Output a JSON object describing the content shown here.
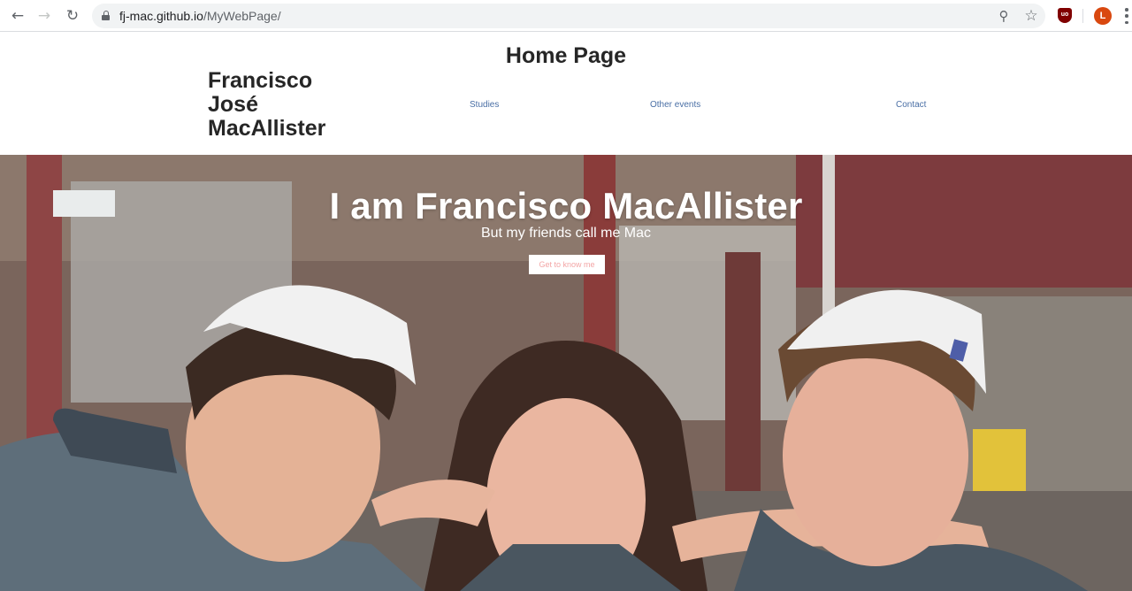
{
  "browser": {
    "url_host": "fj-mac.github.io",
    "url_path": "/MyWebPage/",
    "back_icon": "←",
    "forward_icon": "→",
    "reload_icon": "↻",
    "zoom_icon": "⚲",
    "star_icon": "☆",
    "extension_label": "uo",
    "avatar_letter": "L"
  },
  "header": {
    "page_title": "Home Page",
    "site_name_lines": [
      "Francisco",
      "José",
      "MacAllister"
    ],
    "nav": {
      "studies": "Studies",
      "other_events": "Other events",
      "contact": "Contact"
    }
  },
  "hero": {
    "title": "I am Francisco MacAllister",
    "subtitle": "But my friends call me Mac",
    "cta_label": "Get to know me"
  },
  "colors": {
    "heading": "#262626",
    "nav_link": "#4a6fa5",
    "cta_text": "#f3a5a5",
    "avatar": "#d9480f"
  }
}
